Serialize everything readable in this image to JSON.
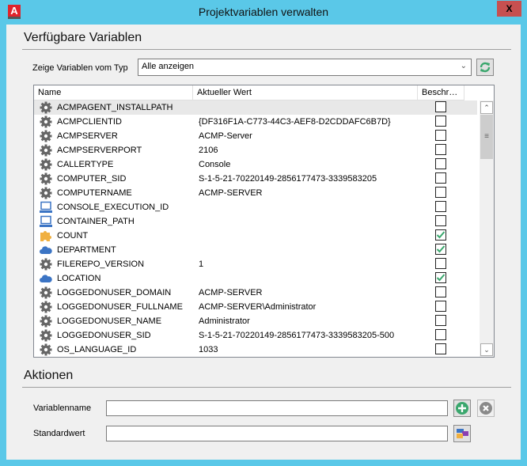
{
  "window": {
    "title": "Projektvariablen verwalten",
    "app_icon_letter": "A",
    "close_label": "X"
  },
  "available": {
    "heading": "Verfügbare Variablen",
    "filter_label": "Zeige Variablen vom Typ",
    "filter_value": "Alle anzeigen"
  },
  "table": {
    "columns": [
      "Name",
      "Aktueller Wert",
      "Beschr…"
    ],
    "rows": [
      {
        "icon": "gear-icon",
        "name": "ACMPAGENT_INSTALLPATH",
        "value": "",
        "checked": false
      },
      {
        "icon": "gear-icon",
        "name": "ACMPCLIENTID",
        "value": "{DF316F1A-C773-44C3-AEF8-D2CDDAFC6B7D}",
        "checked": false
      },
      {
        "icon": "gear-icon",
        "name": "ACMPSERVER",
        "value": "ACMP-Server",
        "checked": false
      },
      {
        "icon": "gear-icon",
        "name": "ACMPSERVERPORT",
        "value": "2106",
        "checked": false
      },
      {
        "icon": "gear-icon",
        "name": "CALLERTYPE",
        "value": "Console",
        "checked": false
      },
      {
        "icon": "gear-icon",
        "name": "COMPUTER_SID",
        "value": "S-1-5-21-70220149-2856177473-3339583205",
        "checked": false
      },
      {
        "icon": "gear-icon",
        "name": "COMPUTERNAME",
        "value": "ACMP-SERVER",
        "checked": false
      },
      {
        "icon": "computer-icon",
        "name": "CONSOLE_EXECUTION_ID",
        "value": "",
        "checked": false
      },
      {
        "icon": "computer-icon",
        "name": "CONTAINER_PATH",
        "value": "",
        "checked": false
      },
      {
        "icon": "puzzle-icon",
        "name": "COUNT",
        "value": "",
        "checked": true
      },
      {
        "icon": "cloud-icon",
        "name": "DEPARTMENT",
        "value": "",
        "checked": true
      },
      {
        "icon": "gear-icon",
        "name": "FILEREPO_VERSION",
        "value": "1",
        "checked": false
      },
      {
        "icon": "cloud-icon",
        "name": "LOCATION",
        "value": "",
        "checked": true
      },
      {
        "icon": "gear-icon",
        "name": "LOGGEDONUSER_DOMAIN",
        "value": "ACMP-SERVER",
        "checked": false
      },
      {
        "icon": "gear-icon",
        "name": "LOGGEDONUSER_FULLNAME",
        "value": "ACMP-SERVER\\Administrator",
        "checked": false
      },
      {
        "icon": "gear-icon",
        "name": "LOGGEDONUSER_NAME",
        "value": "Administrator",
        "checked": false
      },
      {
        "icon": "gear-icon",
        "name": "LOGGEDONUSER_SID",
        "value": "S-1-5-21-70220149-2856177473-3339583205-500",
        "checked": false
      },
      {
        "icon": "gear-icon",
        "name": "OS_LANGUAGE_ID",
        "value": "1033",
        "checked": false
      }
    ]
  },
  "actions": {
    "heading": "Aktionen",
    "varname_label": "Variablenname",
    "varname_value": "",
    "default_label": "Standardwert",
    "default_value": ""
  },
  "colors": {
    "titlebar": "#5ac8e8",
    "close": "#c75050",
    "accent_green": "#3aa76d"
  }
}
